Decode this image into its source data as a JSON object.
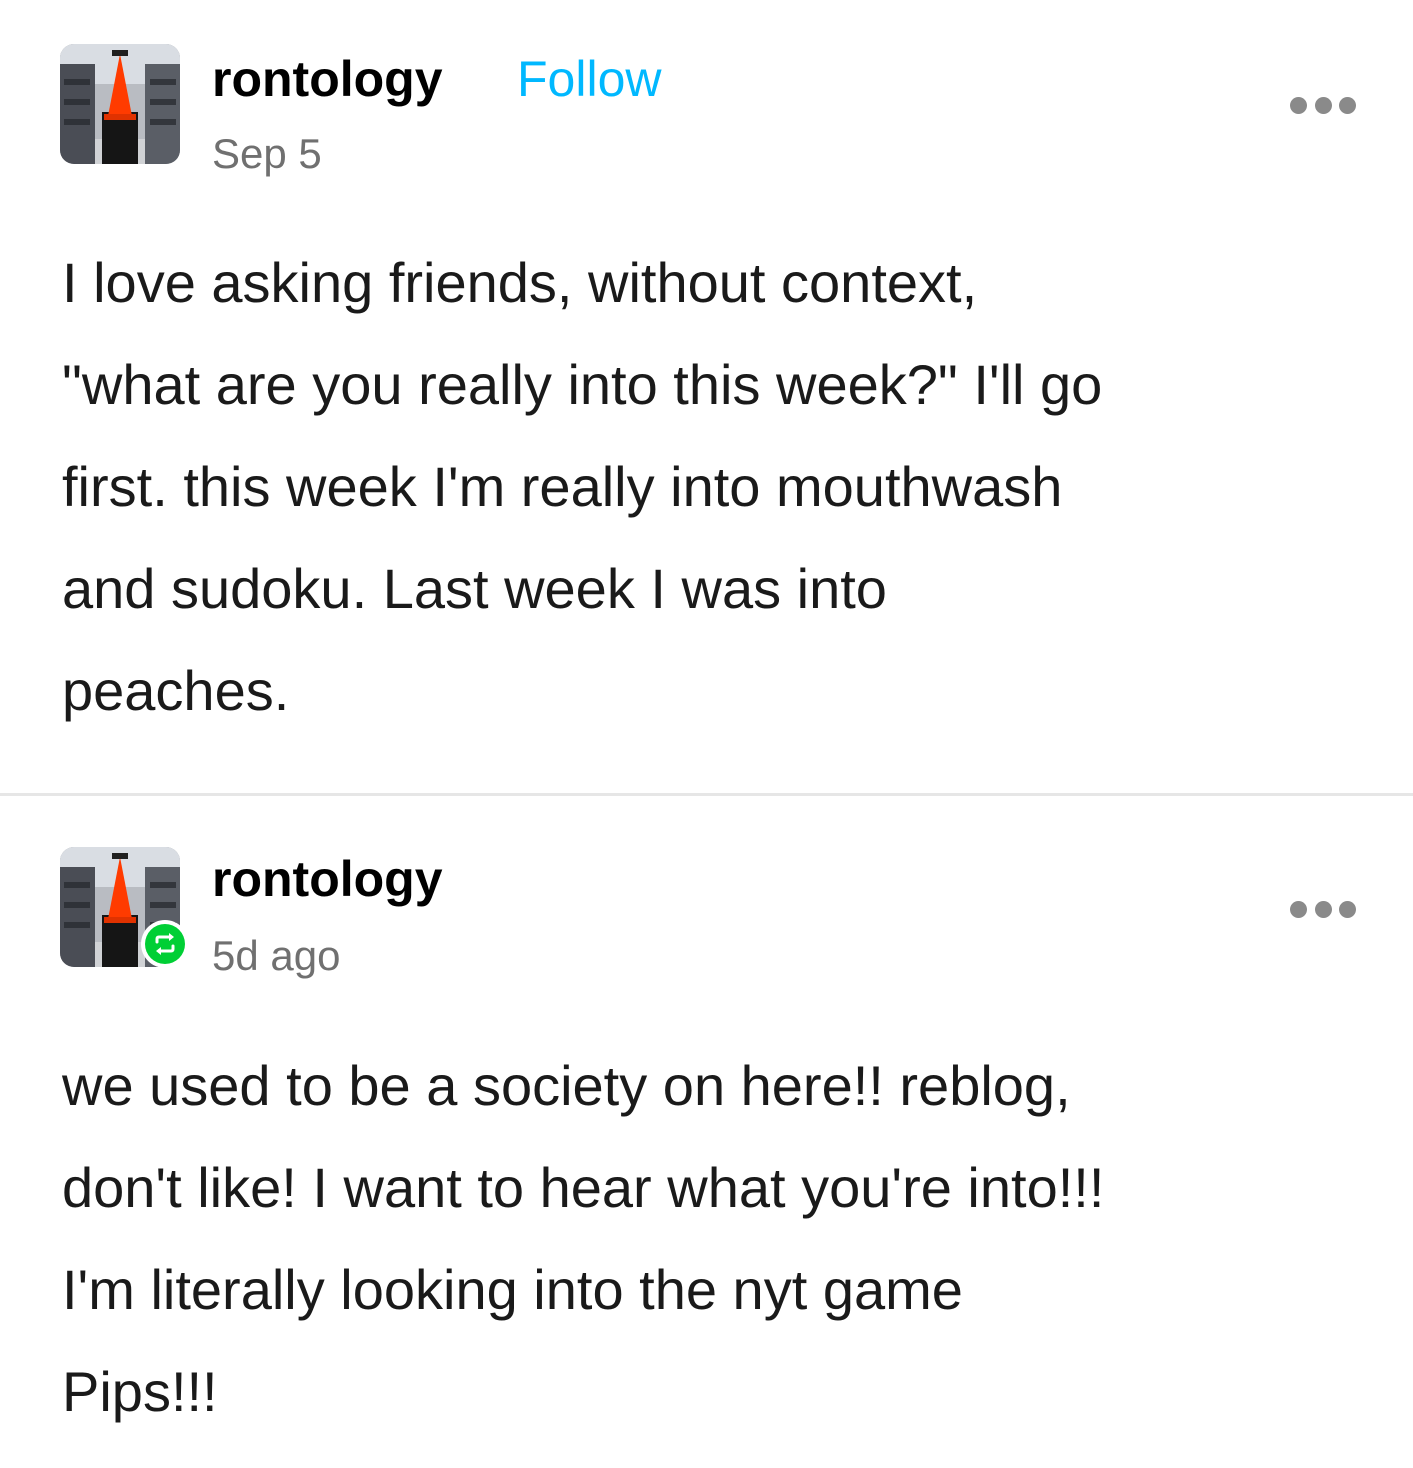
{
  "posts": [
    {
      "username": "rontology",
      "follow_label": "Follow",
      "timestamp": "Sep 5",
      "more_icon": "ellipsis-icon",
      "body_lines": [
        "I love asking friends, without context,",
        "\"what are you really into this week?\" I'll go",
        "first. this week I'm really into mouthwash",
        "and sudoku. Last week I was into",
        "peaches."
      ]
    },
    {
      "username": "rontology",
      "timestamp": "5d ago",
      "badge_icon": "reblog-icon",
      "more_icon": "ellipsis-icon",
      "body_lines": [
        "we used to be a society on here!! reblog,",
        "don't like! I want to hear what you're into!!!",
        "I'm literally looking into the nyt game",
        "Pips!!!"
      ]
    }
  ],
  "colors": {
    "follow": "#00b8ff",
    "reblog_badge": "#00cf35",
    "timestamp": "#707070",
    "divider": "#e6e6e6"
  }
}
